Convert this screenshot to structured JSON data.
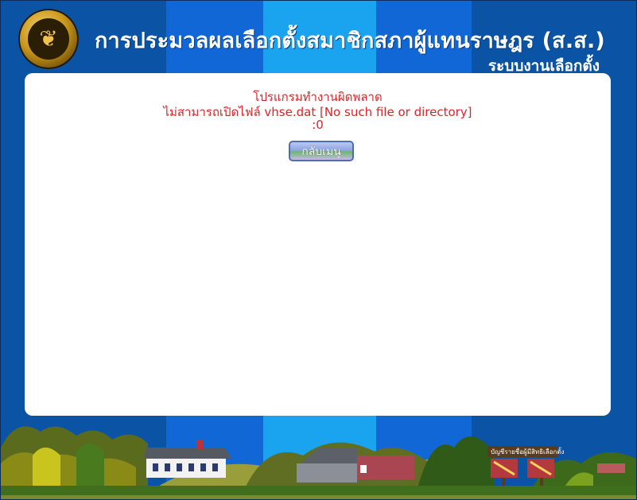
{
  "header": {
    "title": "การประมวลผลเลือกตั้งสมาชิกสภาผู้แทนราษฎร (ส.ส.)",
    "subtitle": "ระบบงานเลือกตั้ง",
    "logo_icon": "garuda-seal-icon"
  },
  "error": {
    "line1": "โปรแกรมทำงานผิดพลาด",
    "line2": "ไม่สามารถเปิดไฟล์ vhse.dat [No such file or directory]",
    "line3": ":0",
    "color": "#d8262a"
  },
  "actions": {
    "back_label": "กลับเมนู"
  },
  "scene": {
    "signboard_text": "บัญชีรายชื่อผู้มีสิทธิเลือกตั้ง"
  },
  "colors": {
    "background": "#0b53a4",
    "band_mid": "#1267d6",
    "band_center": "#1aa3ee",
    "panel": "#ffffff"
  }
}
